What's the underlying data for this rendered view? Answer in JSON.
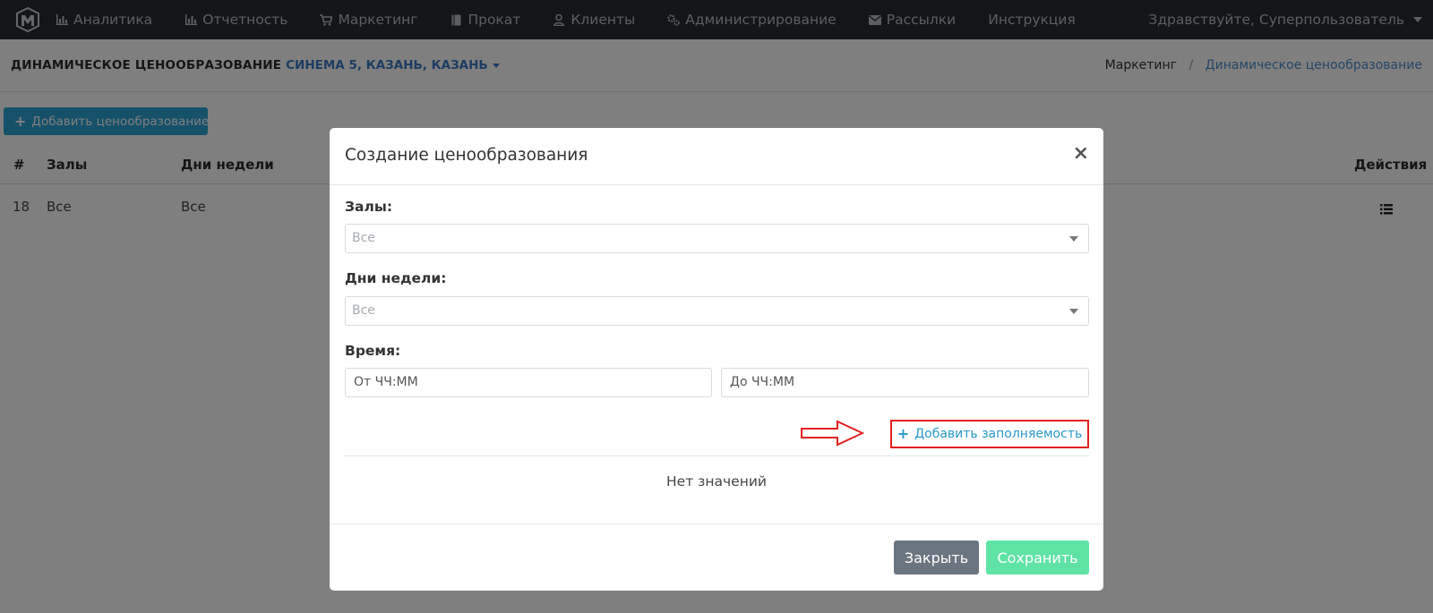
{
  "navbar": {
    "items": [
      {
        "label": "Аналитика",
        "icon": "bar-chart-icon"
      },
      {
        "label": "Отчетность",
        "icon": "bar-chart-icon"
      },
      {
        "label": "Маркетинг",
        "icon": "cart-icon"
      },
      {
        "label": "Прокат",
        "icon": "book-icon"
      },
      {
        "label": "Клиенты",
        "icon": "user-icon"
      },
      {
        "label": "Администрирование",
        "icon": "gears-icon"
      },
      {
        "label": "Рассылки",
        "icon": "envelope-icon"
      },
      {
        "label": "Инструкция",
        "icon": ""
      }
    ],
    "greeting": "Здравствуйте, Суперпользователь"
  },
  "header": {
    "title": "ДИНАМИЧЕСКОЕ ЦЕНООБРАЗОВАНИЕ",
    "cinema": "СИНЕМА 5, КАЗАНЬ, КАЗАНЬ",
    "breadcrumb": {
      "first": "Маркетинг",
      "separator": "/",
      "active": "Динамическое ценообразование"
    }
  },
  "page": {
    "add_button": "Добавить ценообразование",
    "table": {
      "columns": {
        "num": "#",
        "halls": "Залы",
        "days": "Дни недели",
        "actions": "Действия"
      },
      "rows": [
        {
          "num": "18",
          "halls": "Все",
          "days": "Все"
        }
      ]
    }
  },
  "modal": {
    "title": "Создание ценообразования",
    "close_symbol": "×",
    "halls_label": "Залы:",
    "halls_value": "Все",
    "days_label": "Дни недели:",
    "days_value": "Все",
    "time_label": "Время:",
    "time_from_placeholder": "От ЧЧ:ММ",
    "time_to_placeholder": "До ЧЧ:ММ",
    "add_fill_label": "Добавить заполняемость",
    "empty_text": "Нет значений",
    "close_button": "Закрыть",
    "save_button": "Сохранить"
  },
  "colors": {
    "navbar_bg": "#262b33",
    "primary": "#2aa3d3",
    "link": "#3a78c3",
    "highlight_red": "#e52020",
    "save_green": "#5fe3a4",
    "close_gray": "#6b7580"
  }
}
